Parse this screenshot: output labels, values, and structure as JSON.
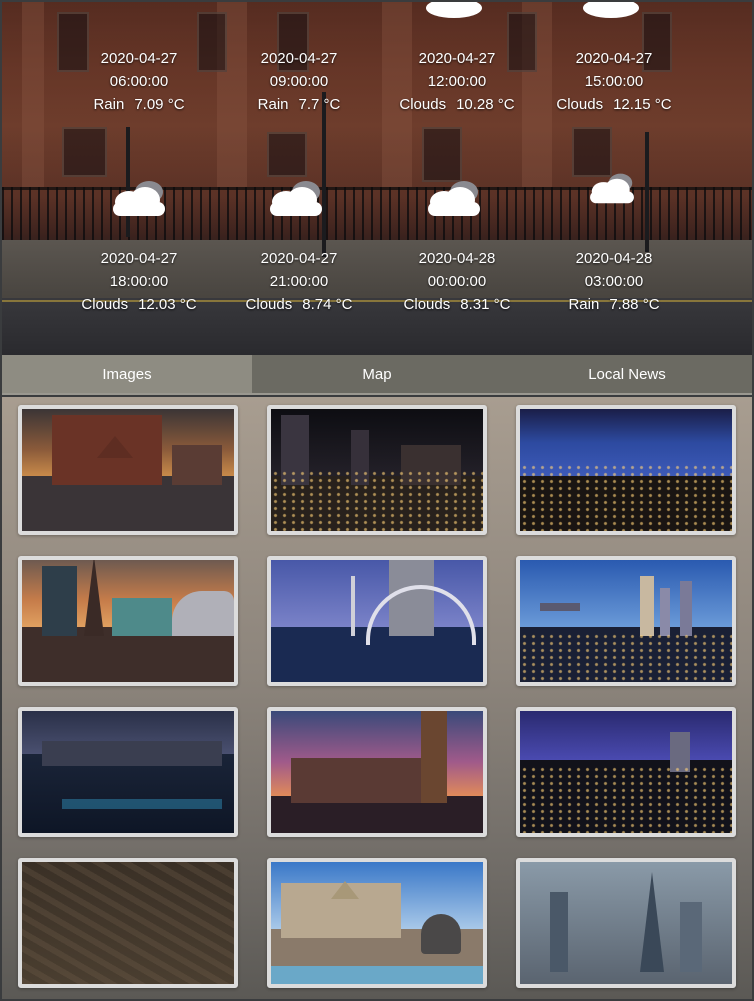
{
  "forecasts": [
    {
      "date": "2020-04-27",
      "time": "06:00:00",
      "condition": "Rain",
      "temp": "7.09 °C"
    },
    {
      "date": "2020-04-27",
      "time": "09:00:00",
      "condition": "Rain",
      "temp": "7.7 °C"
    },
    {
      "date": "2020-04-27",
      "time": "12:00:00",
      "condition": "Clouds",
      "temp": "10.28 °C"
    },
    {
      "date": "2020-04-27",
      "time": "15:00:00",
      "condition": "Clouds",
      "temp": "12.15 °C"
    },
    {
      "date": "2020-04-27",
      "time": "18:00:00",
      "condition": "Clouds",
      "temp": "12.03 °C",
      "icon": "cloud-icon"
    },
    {
      "date": "2020-04-27",
      "time": "21:00:00",
      "condition": "Clouds",
      "temp": "8.74 °C",
      "icon": "cloud-icon"
    },
    {
      "date": "2020-04-28",
      "time": "00:00:00",
      "condition": "Clouds",
      "temp": "8.31 °C",
      "icon": "cloud-icon"
    },
    {
      "date": "2020-04-28",
      "time": "03:00:00",
      "condition": "Rain",
      "temp": "7.88 °C",
      "icon": "cloud-icon"
    }
  ],
  "tabs": {
    "images": "Images",
    "map": "Map",
    "local_news": "Local News",
    "active": "Images"
  },
  "gallery": {
    "thumbnails": [
      {
        "subject": "red brick gothic building under stormy sky"
      },
      {
        "subject": "city skyline at night with light trails"
      },
      {
        "subject": "city panorama at dusk under blue sky"
      },
      {
        "subject": "cathedral spire and city skyline at sunset"
      },
      {
        "subject": "footbridge over river at dusk"
      },
      {
        "subject": "marina bay skyline at blue hour"
      },
      {
        "subject": "canal waterfront at night"
      },
      {
        "subject": "palace of westminster and big ben at sunset"
      },
      {
        "subject": "city skyline lights at night"
      },
      {
        "subject": "aerial view of city at dusk"
      },
      {
        "subject": "council house with fountain statue"
      },
      {
        "subject": "aerial view of financial district towers"
      }
    ]
  },
  "colors": {
    "tab_bar": "#6b6a62",
    "tab_active": "#8e8c82",
    "thumb_border": "#dcdcdc"
  }
}
